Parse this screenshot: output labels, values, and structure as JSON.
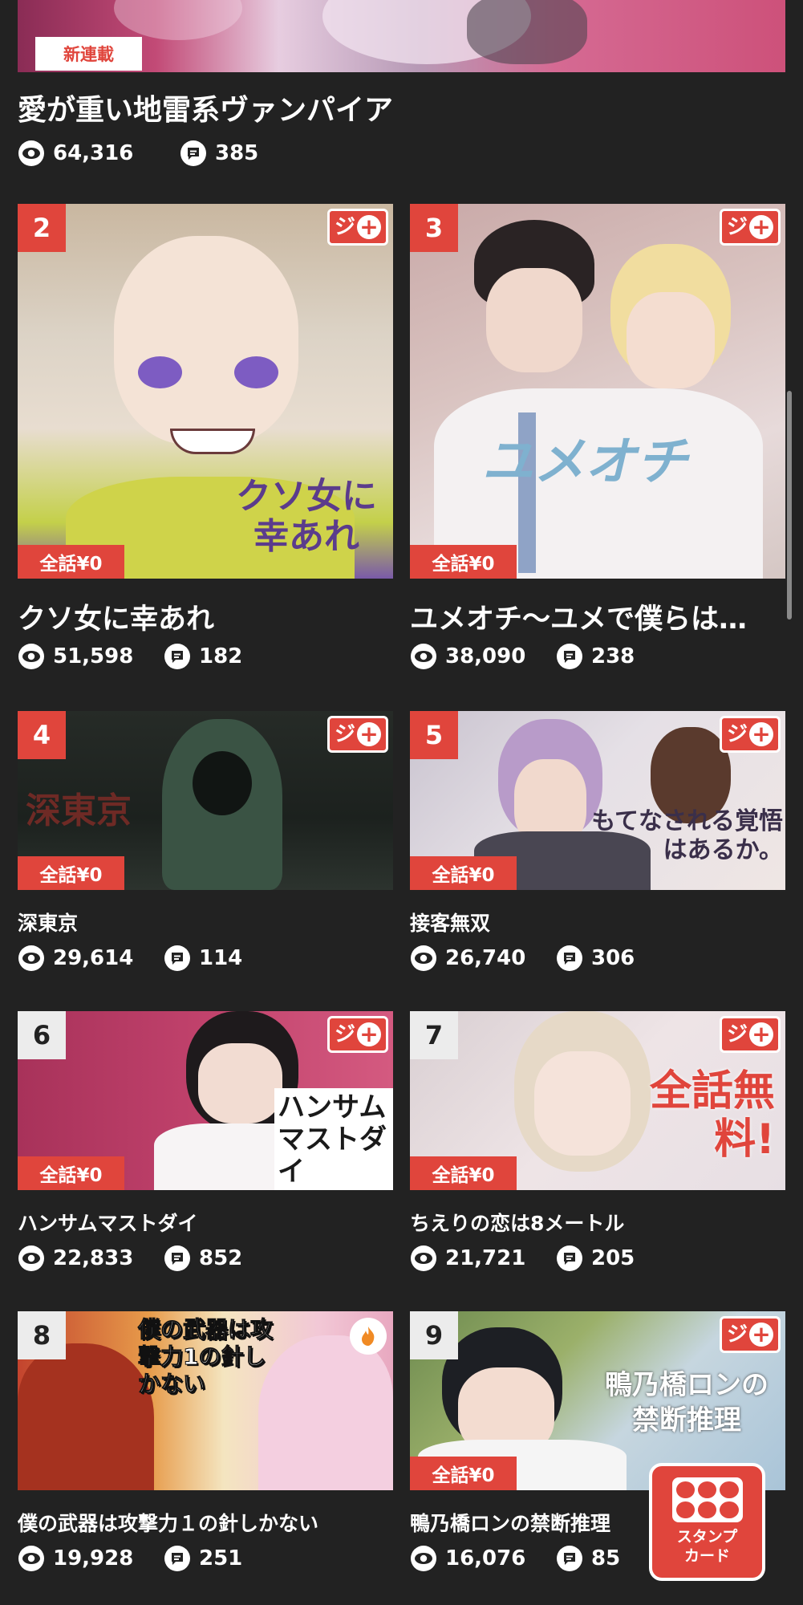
{
  "featured": {
    "badge": "新連載",
    "title": "愛が重い地雷系ヴァンパイア",
    "views": "64,316",
    "comments": "385"
  },
  "free_badge_label": "全話¥0",
  "jump_logo_text": "ジ",
  "cards": [
    {
      "rank": "2",
      "title": "クソ女に幸あれ",
      "views": "51,598",
      "comments": "182",
      "art_text": "クソ女に幸あれ"
    },
    {
      "rank": "3",
      "title": "ユメオチ〜ユメで僕らは…",
      "views": "38,090",
      "comments": "238",
      "art_text": "ユメオチ"
    },
    {
      "rank": "4",
      "title": "深東京",
      "views": "29,614",
      "comments": "114",
      "art_text": "深東京"
    },
    {
      "rank": "5",
      "title": "接客無双",
      "views": "26,740",
      "comments": "306",
      "art_text": "もてなされる覚悟はあるか。"
    },
    {
      "rank": "6",
      "title": "ハンサムマストダイ",
      "views": "22,833",
      "comments": "852",
      "art_text": "ハンサムマストダイ"
    },
    {
      "rank": "7",
      "title": "ちえりの恋は8メートル",
      "views": "21,721",
      "comments": "205",
      "art_text": "全話無料!"
    },
    {
      "rank": "8",
      "title": "僕の武器は攻撃力１の針しかない",
      "views": "19,928",
      "comments": "251",
      "art_text": "僕の武器は攻撃力1の針しかない"
    },
    {
      "rank": "9",
      "title": "鴨乃橋ロンの禁断推理",
      "views": "16,076",
      "comments": "85",
      "art_text": "鴨乃橋ロンの禁断推理"
    }
  ],
  "stamp_card": {
    "line1": "スタンプ",
    "line2": "カード"
  },
  "icons": {
    "views": "eye-icon",
    "comments": "comment-icon"
  },
  "colors": {
    "accent": "#e0453c",
    "background": "#222222"
  }
}
